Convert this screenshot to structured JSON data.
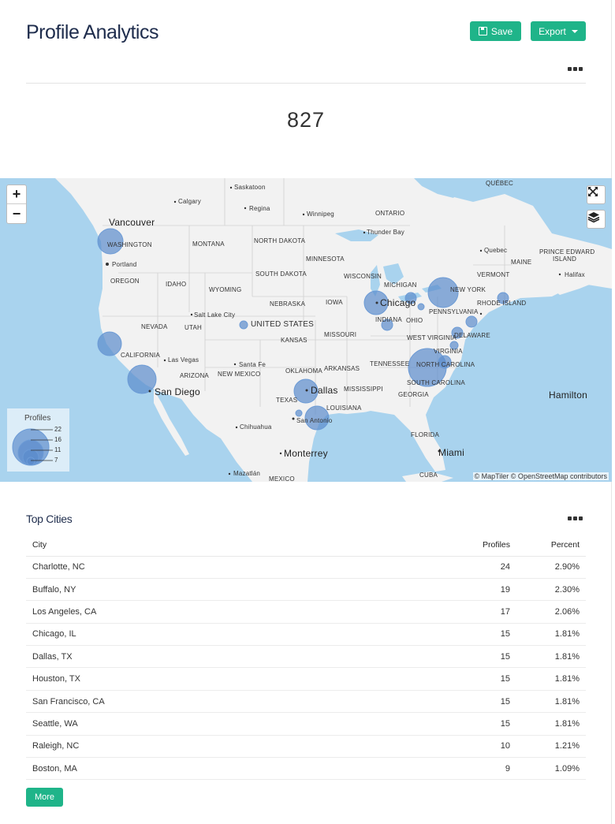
{
  "header": {
    "title": "Profile Analytics",
    "save_label": "Save",
    "export_label": "Export",
    "total_profiles": "827"
  },
  "map": {
    "zoom_in": "+",
    "zoom_out": "−",
    "legend": {
      "title": "Profiles",
      "values": [
        "22",
        "16",
        "11",
        "7"
      ]
    },
    "attribution": "© MapTiler © OpenStreetMap contributors",
    "labels": {
      "saskatoon": "Saskatoon",
      "calgary": "Calgary",
      "regina": "Regina",
      "winnipeg": "Winnipeg",
      "ontario": "ONTARIO",
      "quebec_prov": "QUÉBEC",
      "thunder_bay": "Thunder Bay",
      "vancouver": "Vancouver",
      "washington": "WASHINGTON",
      "montana": "MONTANA",
      "north_dakota": "NORTH DAKOTA",
      "minnesota": "MINNESOTA",
      "quebec_city": "Quebec",
      "maine": "MAINE",
      "pei": "PRINCE EDWARD",
      "pei2": "ISLAND",
      "portland": "Portland",
      "oregon": "OREGON",
      "idaho": "IDAHO",
      "south_dakota": "SOUTH DAKOTA",
      "wisconsin": "WISCONSIN",
      "vermont": "VERMONT",
      "halifax": "Halifax",
      "michigan": "MICHIGAN",
      "wyoming": "WYOMING",
      "new_york": "NEW YORK",
      "chicago": "Chicago",
      "nebraska": "NEBRASKA",
      "iowa": "IOWA",
      "rhode_island": "RHODE ISLAND",
      "salt_lake": "Salt Lake City",
      "pennsylvania": "PENNSYLVANIA",
      "nevada": "NEVADA",
      "utah": "UTAH",
      "united_states": "UNITED STATES",
      "indiana": "INDIANA",
      "ohio": "OHIO",
      "kansas": "KANSAS",
      "missouri": "MISSOURI",
      "west_virginia": "WEST VIRGINIA",
      "delaware": "DELAWARE",
      "california": "CALIFORNIA",
      "virginia": "VIRGINIA",
      "las_vegas": "Las Vegas",
      "santa_fe": "Santa Fe",
      "tennessee": "TENNESSEE",
      "north_carolina": "NORTH CAROLINA",
      "oklahoma": "OKLAHOMA",
      "arkansas": "ARKANSAS",
      "arizona": "ARIZONA",
      "new_mexico": "NEW MEXICO",
      "san_diego": "San Diego",
      "dallas": "Dallas",
      "mississippi": "MISSISSIPPI",
      "south_carolina": "SOUTH CAROLINA",
      "texas": "TEXAS",
      "georgia": "GEORGIA",
      "hamilton": "Hamilton",
      "louisiana": "LOUISIANA",
      "san_antonio": "San Antonio",
      "chihuahua": "Chihuahua",
      "florida": "FLORIDA",
      "monterrey": "Monterrey",
      "miami": "Miami",
      "mazatlan": "Mazatlán",
      "cuba": "CUBA",
      "mexico": "MEXICO"
    }
  },
  "top_cities": {
    "title": "Top Cities",
    "columns": {
      "city": "City",
      "profiles": "Profiles",
      "percent": "Percent"
    },
    "rows": [
      {
        "city": "Charlotte, NC",
        "profiles": "24",
        "percent": "2.90%"
      },
      {
        "city": "Buffalo, NY",
        "profiles": "19",
        "percent": "2.30%"
      },
      {
        "city": "Los Angeles, CA",
        "profiles": "17",
        "percent": "2.06%"
      },
      {
        "city": "Chicago, IL",
        "profiles": "15",
        "percent": "1.81%"
      },
      {
        "city": "Dallas, TX",
        "profiles": "15",
        "percent": "1.81%"
      },
      {
        "city": "Houston, TX",
        "profiles": "15",
        "percent": "1.81%"
      },
      {
        "city": "San Francisco, CA",
        "profiles": "15",
        "percent": "1.81%"
      },
      {
        "city": "Seattle, WA",
        "profiles": "15",
        "percent": "1.81%"
      },
      {
        "city": "Raleigh, NC",
        "profiles": "10",
        "percent": "1.21%"
      },
      {
        "city": "Boston, MA",
        "profiles": "9",
        "percent": "1.09%"
      }
    ],
    "more_label": "More"
  }
}
